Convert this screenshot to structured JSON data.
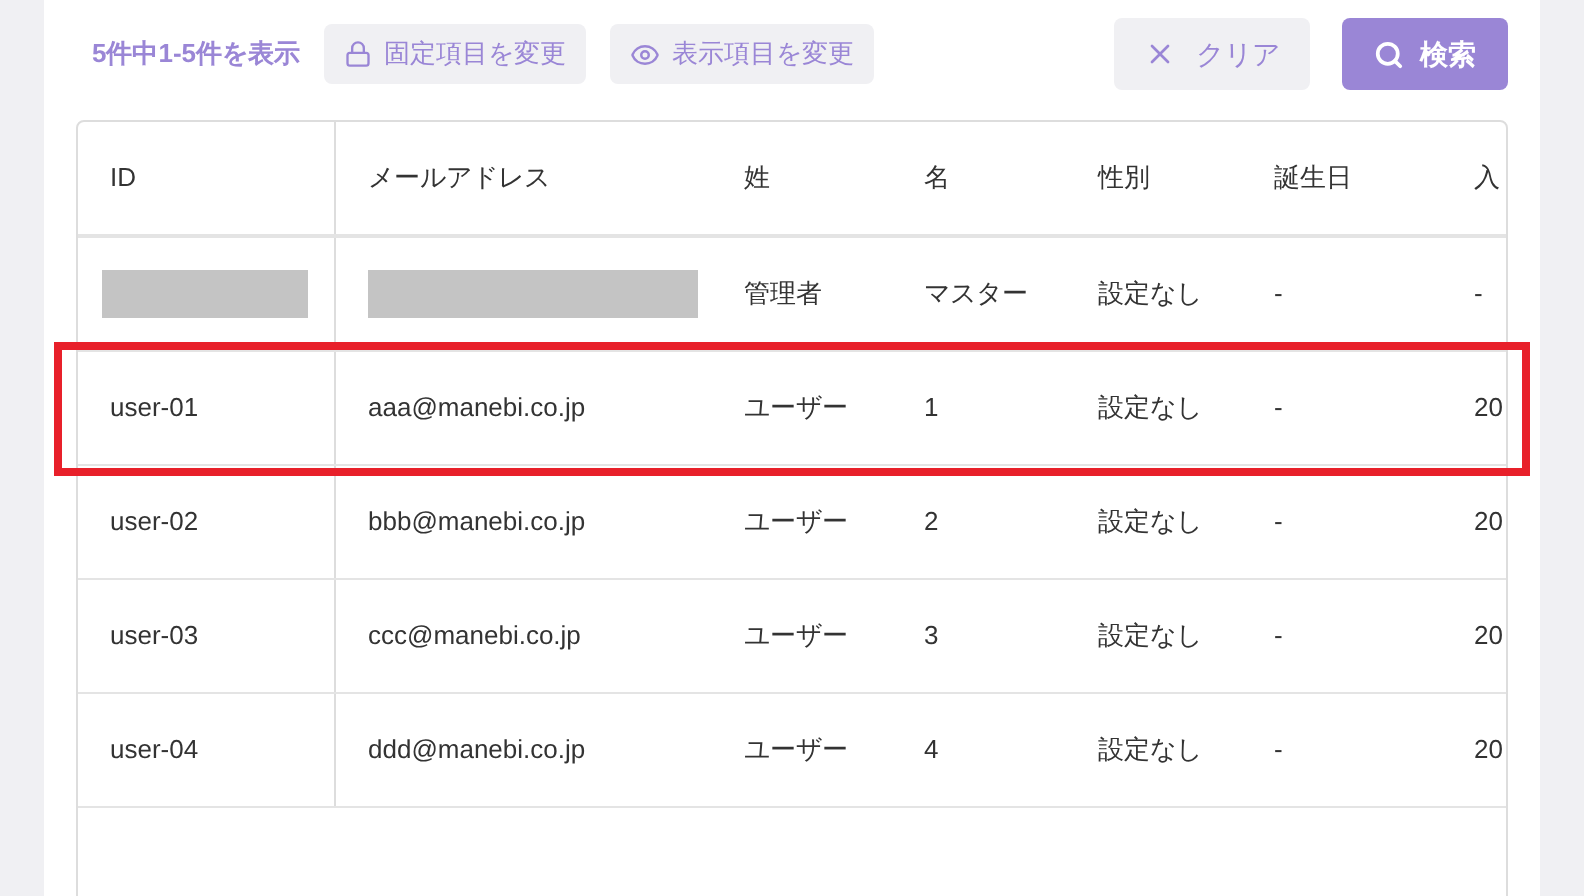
{
  "toolbar": {
    "count_text": "5件中1-5件を表示",
    "buttons": [
      {
        "kind": "lock",
        "label": "固定項目を変更"
      },
      {
        "kind": "eye",
        "label": "表示項目を変更"
      }
    ],
    "clear_button": "クリア",
    "search_button": "検索"
  },
  "table": {
    "columns": [
      "ID",
      "メールアドレス",
      "姓",
      "名",
      "性別",
      "誕生日",
      "入"
    ],
    "rows": [
      {
        "highlighted": false,
        "cells": [
          {
            "kind": "redacted"
          },
          {
            "kind": "redacted"
          },
          {
            "kind": "text",
            "text": "管理者"
          },
          {
            "kind": "text",
            "text": "マスター"
          },
          {
            "kind": "text",
            "text": "設定なし"
          },
          {
            "kind": "text",
            "text": "-"
          },
          {
            "kind": "text",
            "text": "-"
          }
        ]
      },
      {
        "highlighted": true,
        "cells": [
          {
            "kind": "text",
            "text": "user-01"
          },
          {
            "kind": "text",
            "text": "aaa@manebi.co.jp"
          },
          {
            "kind": "text",
            "text": "ユーザー"
          },
          {
            "kind": "text",
            "text": "1"
          },
          {
            "kind": "text",
            "text": "設定なし"
          },
          {
            "kind": "text",
            "text": "-"
          },
          {
            "kind": "text",
            "text": "20"
          }
        ]
      },
      {
        "highlighted": false,
        "cells": [
          {
            "kind": "text",
            "text": "user-02"
          },
          {
            "kind": "text",
            "text": "bbb@manebi.co.jp"
          },
          {
            "kind": "text",
            "text": "ユーザー"
          },
          {
            "kind": "text",
            "text": "2"
          },
          {
            "kind": "text",
            "text": "設定なし"
          },
          {
            "kind": "text",
            "text": "-"
          },
          {
            "kind": "text",
            "text": "20"
          }
        ]
      },
      {
        "highlighted": false,
        "cells": [
          {
            "kind": "text",
            "text": "user-03"
          },
          {
            "kind": "text",
            "text": "ccc@manebi.co.jp"
          },
          {
            "kind": "text",
            "text": "ユーザー"
          },
          {
            "kind": "text",
            "text": "3"
          },
          {
            "kind": "text",
            "text": "設定なし"
          },
          {
            "kind": "text",
            "text": "-"
          },
          {
            "kind": "text",
            "text": "20"
          }
        ]
      },
      {
        "highlighted": false,
        "cells": [
          {
            "kind": "text",
            "text": "user-04"
          },
          {
            "kind": "text",
            "text": "ddd@manebi.co.jp"
          },
          {
            "kind": "text",
            "text": "ユーザー"
          },
          {
            "kind": "text",
            "text": "4"
          },
          {
            "kind": "text",
            "text": "設定なし"
          },
          {
            "kind": "text",
            "text": "-"
          },
          {
            "kind": "text",
            "text": "20"
          }
        ]
      }
    ]
  }
}
